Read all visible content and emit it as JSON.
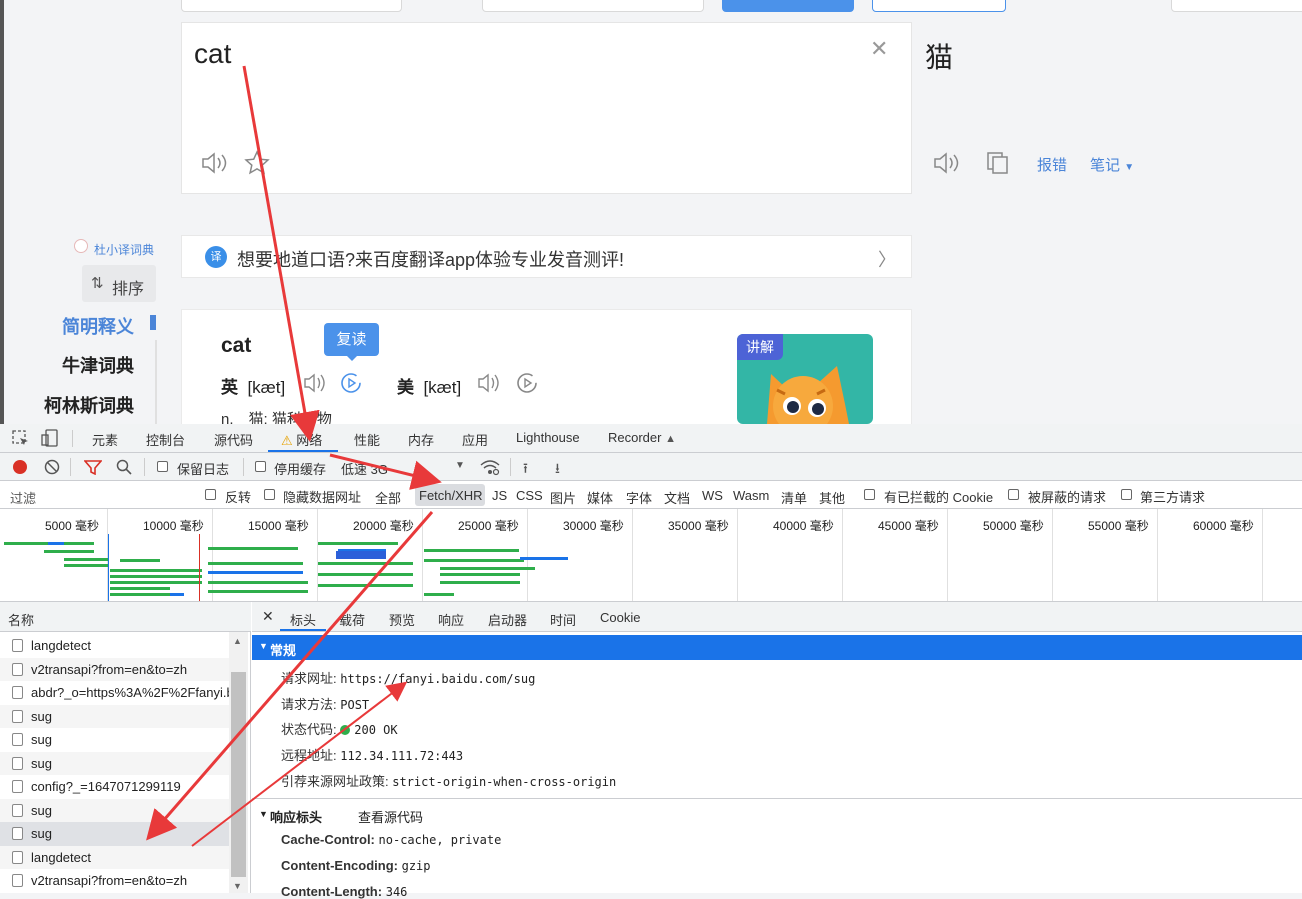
{
  "translator": {
    "source_text": "cat",
    "target_text": "猫",
    "report_error": "报错",
    "notes": "笔记",
    "banner_text": "想要地道口语?来百度翻译app体验专业发音测评!",
    "side_assistant": "杜小译词典",
    "sort_label": "排序",
    "side_items": [
      "简明释义",
      "牛津词典",
      "柯林斯词典"
    ],
    "dict_word": "cat",
    "tooltip": "复读",
    "uk_label": "英",
    "uk_phonetic": "[kæt]",
    "us_label": "美",
    "us_phonetic": "[kæt]",
    "definition": "n.　猫; 猫科动物",
    "lesson_tag": "讲解"
  },
  "devtools": {
    "tabs": [
      "元素",
      "控制台",
      "源代码",
      "网络",
      "性能",
      "内存",
      "应用",
      "Lighthouse",
      "Recorder"
    ],
    "active_tab": "网络",
    "preserve_log": "保留日志",
    "disable_cache": "停用缓存",
    "throttle": "低速 3G",
    "filter_placeholder": "过滤",
    "invert": "反转",
    "hide_data_urls": "隐藏数据网址",
    "type_filters": [
      "全部",
      "Fetch/XHR",
      "JS",
      "CSS",
      "图片",
      "媒体",
      "字体",
      "文档",
      "WS",
      "Wasm",
      "清单",
      "其他"
    ],
    "active_type_filter": "Fetch/XHR",
    "blocked_cookies": "有已拦截的 Cookie",
    "blocked_requests": "被屏蔽的请求",
    "third_party": "第三方请求",
    "timeline_ticks": [
      "5000 毫秒",
      "10000 毫秒",
      "15000 毫秒",
      "20000 毫秒",
      "25000 毫秒",
      "30000 毫秒",
      "35000 毫秒",
      "40000 毫秒",
      "45000 毫秒",
      "50000 毫秒",
      "55000 毫秒",
      "60000 毫秒"
    ],
    "name_column": "名称",
    "requests": [
      "langdetect",
      "v2transapi?from=en&to=zh",
      "abdr?_o=https%3A%2F%2Ffanyi.baidu.com",
      "sug",
      "sug",
      "sug",
      "config?_=1647071299119",
      "sug",
      "sug",
      "langdetect",
      "v2transapi?from=en&to=zh"
    ],
    "selected_request_index": 8,
    "detail_tabs": [
      "标头",
      "载荷",
      "预览",
      "响应",
      "启动器",
      "时间",
      "Cookie"
    ],
    "active_detail_tab": "标头",
    "general_title": "常规",
    "general": [
      {
        "key": "请求网址:",
        "value": "https://fanyi.baidu.com/sug"
      },
      {
        "key": "请求方法:",
        "value": "POST"
      },
      {
        "key": "状态代码:",
        "value": "200 OK"
      },
      {
        "key": "远程地址:",
        "value": "112.34.111.72:443"
      },
      {
        "key": "引荐来源网址政策:",
        "value": "strict-origin-when-cross-origin"
      }
    ],
    "response_headers_title": "响应标头",
    "view_source": "查看源代码",
    "response_headers": [
      {
        "key": "Cache-Control:",
        "value": "no-cache, private"
      },
      {
        "key": "Content-Encoding:",
        "value": "gzip"
      },
      {
        "key": "Content-Length:",
        "value": "346"
      }
    ]
  },
  "colors": {
    "accent": "#1a73e8",
    "arrow": "#e8393a",
    "link": "#4b85d8",
    "waterfall_green": "#2fae4b"
  }
}
